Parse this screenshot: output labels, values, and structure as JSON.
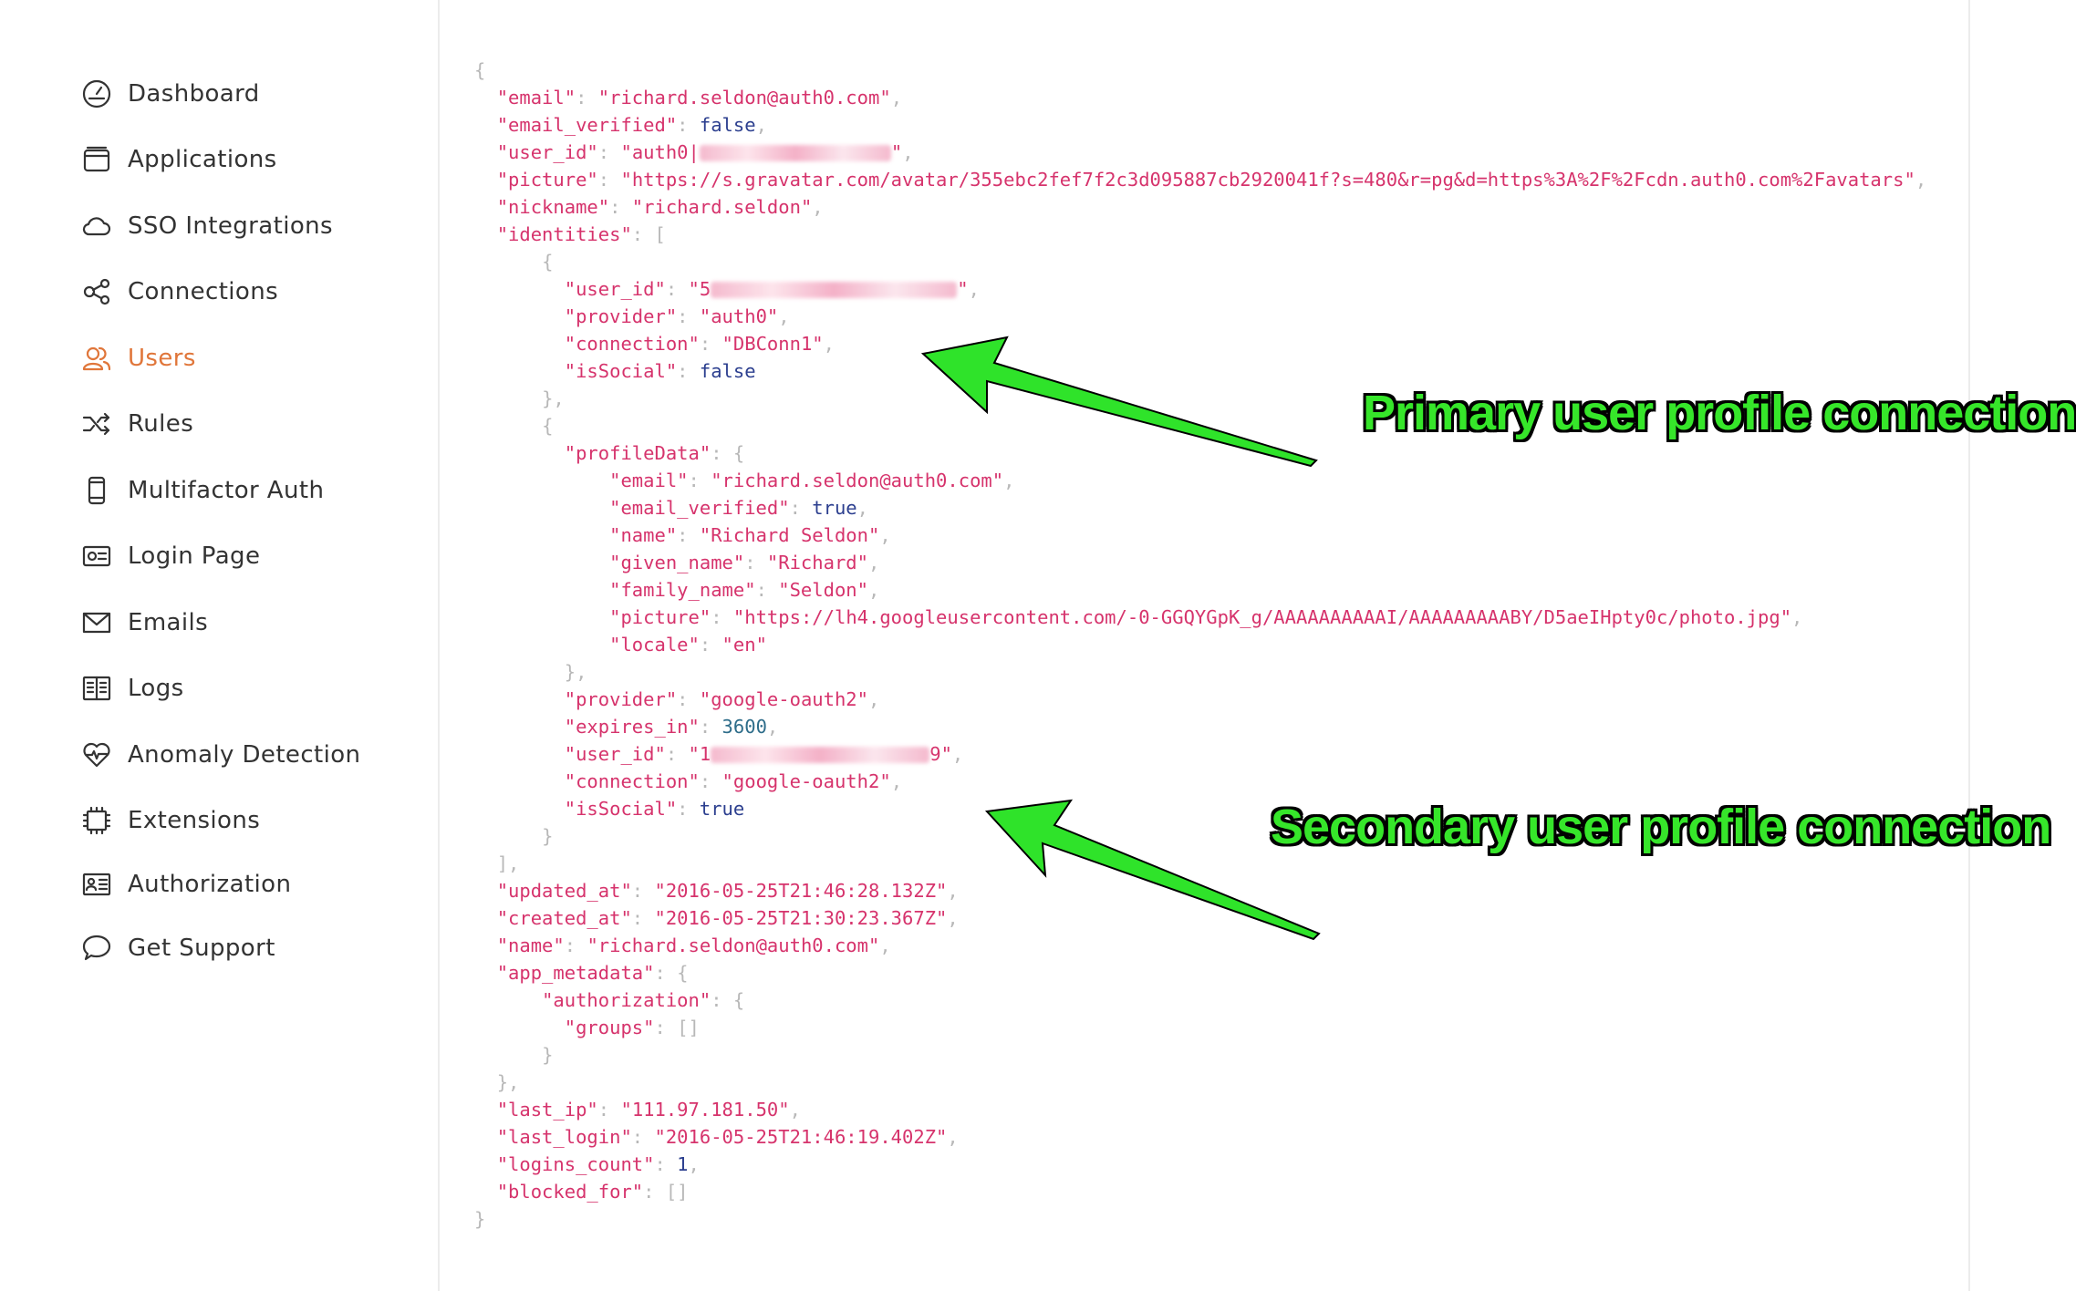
{
  "sidebar": {
    "items": [
      {
        "label": "Dashboard",
        "icon": "dashboard-icon",
        "active": false
      },
      {
        "label": "Applications",
        "icon": "applications-icon",
        "active": false
      },
      {
        "label": "SSO Integrations",
        "icon": "cloud-icon",
        "active": false
      },
      {
        "label": "Connections",
        "icon": "connections-icon",
        "active": false
      },
      {
        "label": "Users",
        "icon": "users-icon",
        "active": true
      },
      {
        "label": "Rules",
        "icon": "shuffle-icon",
        "active": false
      },
      {
        "label": "Multifactor Auth",
        "icon": "phone-icon",
        "active": false
      },
      {
        "label": "Login Page",
        "icon": "login-page-icon",
        "active": false
      },
      {
        "label": "Emails",
        "icon": "envelope-icon",
        "active": false
      },
      {
        "label": "Logs",
        "icon": "book-icon",
        "active": false
      },
      {
        "label": "Anomaly Detection",
        "icon": "heart-pulse-icon",
        "active": false
      },
      {
        "label": "Extensions",
        "icon": "chip-icon",
        "active": false
      },
      {
        "label": "Authorization",
        "icon": "id-card-icon",
        "active": false
      },
      {
        "label": "Get Support",
        "icon": "chat-bubble-icon",
        "active": false
      }
    ],
    "active_color": "#e0763a"
  },
  "json_view": {
    "email": "richard.seldon@auth0.com",
    "email_verified": "false",
    "user_id_prefix": "auth0|",
    "picture": "https://s.gravatar.com/avatar/355ebc2fef7f2c3d095887cb2920041f?s=480&r=pg&d=https%3A%2F%2Fcdn.auth0.com%2Favatars",
    "nickname": "richard.seldon",
    "identity_1": {
      "user_id_prefix": "5",
      "provider": "auth0",
      "connection": "DBConn1",
      "isSocial": "false"
    },
    "identity_2": {
      "profileData": {
        "email": "richard.seldon@auth0.com",
        "email_verified": "true",
        "name": "Richard Seldon",
        "given_name": "Richard",
        "family_name": "Seldon",
        "picture": "https://lh4.googleusercontent.com/-0-GGQYGpK_g/AAAAAAAAAAI/AAAAAAAAABY/D5aeIHpty0c/photo.jpg",
        "locale": "en"
      },
      "provider": "google-oauth2",
      "expires_in": "3600",
      "user_id_prefix": "1",
      "user_id_suffix": "9",
      "connection": "google-oauth2",
      "isSocial": "true"
    },
    "updated_at": "2016-05-25T21:46:28.132Z",
    "created_at": "2016-05-25T21:30:23.367Z",
    "name": "richard.seldon@auth0.com",
    "groups": "[]",
    "last_ip": "111.97.181.50",
    "last_login": "2016-05-25T21:46:19.402Z",
    "logins_count": "1",
    "blocked_for": "[]"
  },
  "annotations": {
    "primary": "Primary user profile connection",
    "secondary": "Secondary user profile connection",
    "color": "#36e62a"
  }
}
